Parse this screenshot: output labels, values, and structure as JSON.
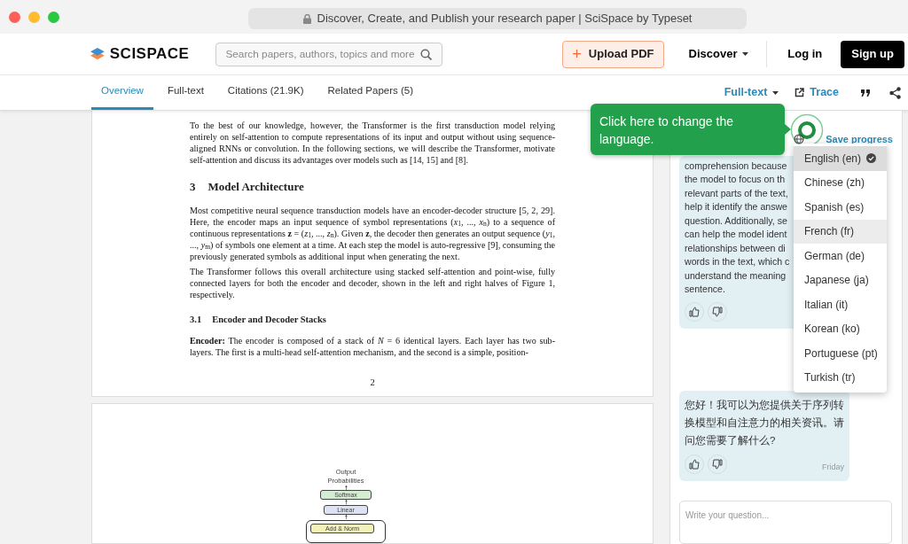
{
  "browser": {
    "title": "Discover, Create, and Publish your research paper | SciSpace by Typeset"
  },
  "header": {
    "logo": "SCISPACE",
    "search": {
      "placeholder": "Search papers, authors, topics and more"
    },
    "upload": {
      "icon": "+",
      "label": "Upload PDF"
    },
    "discover": "Discover",
    "login": "Log in",
    "signup": "Sign up"
  },
  "tabs": [
    {
      "label": "Overview",
      "selected": true
    },
    {
      "label": "Full-text",
      "selected": false
    },
    {
      "label": "Citations (21.9K)",
      "selected": false
    },
    {
      "label": "Related Papers (5)",
      "selected": false
    }
  ],
  "toolbar": {
    "view": "Full-text",
    "trace": "Trace"
  },
  "pdf": {
    "page_1": [
      {
        "kind": "paragraph",
        "text": "To the best of our knowledge, however, the Transformer is the first transduction model relying entirely on self-attention to compute representations of its input and output without using sequence-aligned RNNs or convolution. In the following sections, we will describe the Transformer, motivate self-attention and discuss its advantages over models such as [14, 15] and [8]."
      },
      {
        "kind": "heading",
        "number": "3",
        "text": "Model Architecture"
      },
      {
        "kind": "paragraph",
        "text": "Most competitive neural sequence transduction models have an encoder-decoder structure [5, 2, 29]. Here, the encoder maps an input sequence of symbol representations (*x*$_{1}$, ..., *x*$_{n}$) to a sequence of continuous representations **z** = (*z*$_{1}$, ..., *z*$_{n}$). Given **z**, the decoder then generates an output sequence (*y*$_{1}$, ..., *y*$_{m}$) of symbols one element at a time. At each step the model is auto-regressive [9], consuming the previously generated symbols as additional input when generating the next."
      },
      {
        "kind": "paragraph",
        "text": "The Transformer follows this overall architecture using stacked self-attention and point-wise, fully connected layers for both the encoder and decoder, shown in the left and right halves of Figure 1, respectively."
      },
      {
        "kind": "subheading",
        "number": "3.1",
        "text": "Encoder and Decoder Stacks"
      },
      {
        "kind": "paragraph",
        "text": "**Encoder:**   The encoder is composed of a stack of *N* = 6 identical layers. Each layer has two sub-layers. The first is a multi-head self-attention mechanism, and the second is a simple, position-"
      }
    ],
    "page_number": "2",
    "figure": {
      "caption_lines": [
        "Output",
        "Probabilities"
      ],
      "blocks": [
        {
          "label": "Softmax",
          "color": "#d4ecd2",
          "framed": false
        },
        {
          "label": "Linear",
          "color": "#dde2f4",
          "framed": false
        },
        {
          "label": "Add & Norm",
          "color": "#f3f2b8",
          "framed": true
        }
      ]
    }
  },
  "chat": {
    "save": "Save progress",
    "tooltip": "Click here to change the language.",
    "messages": [
      {
        "lines": [
          "comprehension because",
          "the model to focus on th",
          "relevant parts of the text,",
          "help it identify the answe",
          "question. Additionally, se",
          "can help the model ident",
          "relationships between di",
          "words in the text, which c",
          "understand the meaning",
          "sentence."
        ]
      },
      {
        "lines": [
          "您好！我可以为您提供关于序列转",
          "换模型和自注意力的相关资讯。请",
          "问您需要了解什么?"
        ],
        "time": "Friday"
      }
    ],
    "input": {
      "placeholder": "Write your question..."
    }
  },
  "languages": [
    {
      "label": "English (en)",
      "selected": true,
      "highlighted": false
    },
    {
      "label": "Chinese (zh)",
      "selected": false,
      "highlighted": false
    },
    {
      "label": "Spanish (es)",
      "selected": false,
      "highlighted": false
    },
    {
      "label": "French (fr)",
      "selected": false,
      "highlighted": true
    },
    {
      "label": "German (de)",
      "selected": false,
      "highlighted": false
    },
    {
      "label": "Japanese (ja)",
      "selected": false,
      "highlighted": false
    },
    {
      "label": "Italian (it)",
      "selected": false,
      "highlighted": false
    },
    {
      "label": "Korean (ko)",
      "selected": false,
      "highlighted": false
    },
    {
      "label": "Portuguese (pt)",
      "selected": false,
      "highlighted": false
    },
    {
      "label": "Turkish (tr)",
      "selected": false,
      "highlighted": false
    }
  ]
}
